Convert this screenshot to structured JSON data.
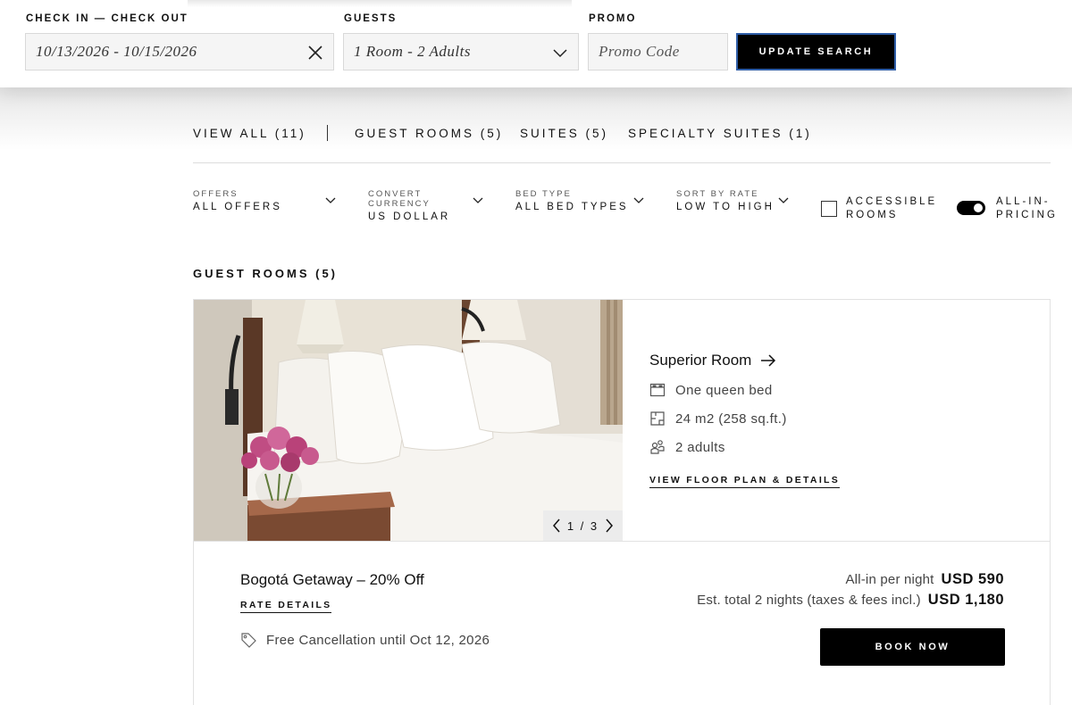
{
  "search": {
    "dates_label": "CHECK IN — CHECK OUT",
    "dates_value": "10/13/2026 - 10/15/2026",
    "guests_label": "GUESTS",
    "guests_value": "1 Room - 2 Adults",
    "promo_label": "PROMO",
    "promo_placeholder": "Promo Code",
    "update_button": "UPDATE SEARCH"
  },
  "tabs": [
    {
      "label": "VIEW ALL (11)"
    },
    {
      "label": "GUEST ROOMS (5)"
    },
    {
      "label": "SUITES (5)"
    },
    {
      "label": "SPECIALTY SUITES (1)"
    }
  ],
  "filters": {
    "offers": {
      "label": "OFFERS",
      "value": "ALL OFFERS"
    },
    "currency": {
      "label": "CONVERT CURRENCY",
      "value": "US DOLLAR"
    },
    "bed_type": {
      "label": "BED TYPE",
      "value": "ALL BED TYPES"
    },
    "sort": {
      "label": "SORT BY RATE",
      "value": "LOW TO HIGH"
    },
    "accessible": {
      "label": "ACCESSIBLE ROOMS",
      "checked": false
    },
    "all_in_pricing": {
      "label": "ALL-IN-PRICING",
      "on": true
    }
  },
  "section_title": "GUEST ROOMS (5)",
  "room": {
    "name": "Superior Room",
    "bed": "One queen bed",
    "size": "24 m2 (258 sq.ft.)",
    "occupancy": "2 adults",
    "floor_plan_link": "VIEW FLOOR PLAN & DETAILS",
    "photo_counter": "1 / 3",
    "photo_current": 1,
    "photo_total": 3
  },
  "rate": {
    "name": "Bogotá Getaway – 20% Off",
    "details_link": "RATE DETAILS",
    "cancellation": "Free Cancellation until Oct 12, 2026",
    "per_night_label": "All-in per night",
    "per_night_value": "USD 590",
    "total_label": "Est. total 2 nights (taxes & fees incl.)",
    "total_value": "USD 1,180",
    "book_button": "BOOK NOW"
  },
  "colors": {
    "accent": "#000000",
    "focus_border": "#2f5ea8",
    "field_bg": "#f5f5f5"
  }
}
